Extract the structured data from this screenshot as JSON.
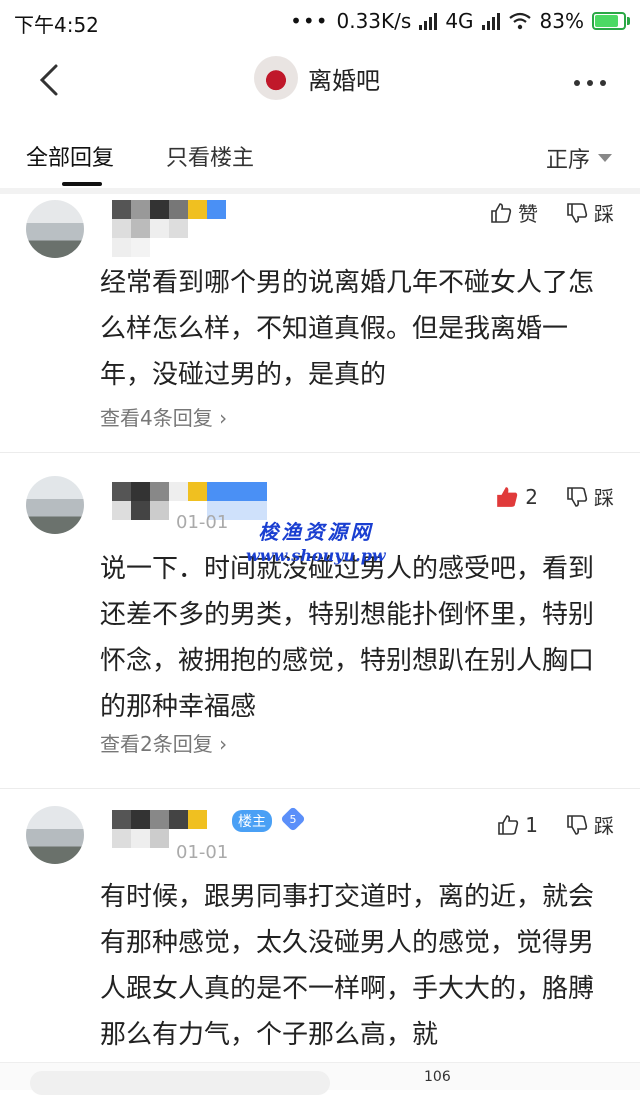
{
  "status_bar": {
    "time": "下午4:52",
    "net_speed": "0.33K/s",
    "network": "4G",
    "battery": "83%",
    "battery_level": 0.83
  },
  "nav": {
    "forum_name": "离婚吧"
  },
  "tabs": {
    "all": "全部回复",
    "op_only": "只看楼主",
    "sort": "正序"
  },
  "posts": [
    {
      "like_label": "赞",
      "dislike_label": "踩",
      "content": "经常看到哪个男的说离婚几年不碰女人了怎么样怎么样，不知道真假。但是我离婚一年，没碰过男的，是真的",
      "replies": "查看4条回复"
    },
    {
      "like_count": "2",
      "dislike_label": "踩",
      "date": "01-01",
      "content": "说一下．时间就没碰过男人的感受吧，看到还差不多的男类，特别想能扑倒怀里，特别怀念，被拥抱的感觉，特别想趴在别人胸口的那种幸福感",
      "replies": "查看2条回复"
    },
    {
      "badge": "楼主",
      "level": "5",
      "like_count": "1",
      "dislike_label": "踩",
      "date": "01-01",
      "content": "有时候，跟男同事打交道时，离的近，就会有那种感觉，太久没碰男人的感觉，觉得男人跟女人真的是不一样啊，手大大的，胳膊那么有力气，个子那么高，就"
    }
  ],
  "watermark": {
    "line1": "梭渔资源网",
    "line2": "www.shouyu.pw"
  },
  "bottom": {
    "count": "106"
  },
  "colors": {
    "like_active": "#e03a3a",
    "badge": "#4aa0f5",
    "watermark": "#1a3fd1"
  }
}
